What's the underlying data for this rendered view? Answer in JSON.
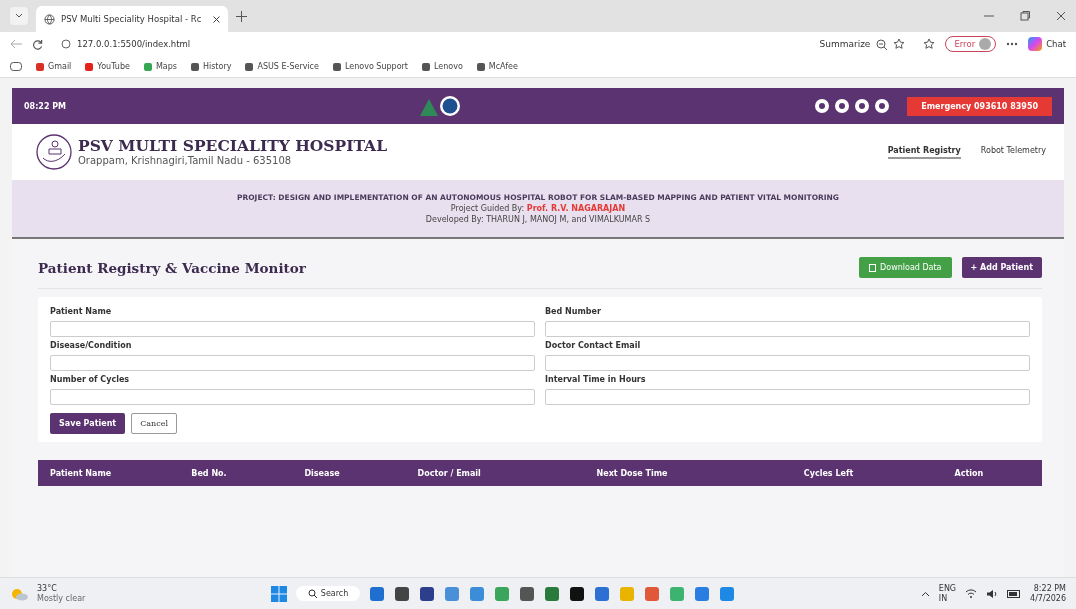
{
  "browser": {
    "tabs": [
      {
        "title": "PSV Multi Speciality Hospital - Rc",
        "selected": true
      }
    ],
    "url": "127.0.0.1:5500/index.html",
    "summarize": "Summarize",
    "profile": "Error",
    "chat": "Chat",
    "bookmarks": [
      {
        "label": "Gmail",
        "color": "#d93025"
      },
      {
        "label": "YouTube",
        "color": "#e62117"
      },
      {
        "label": "Maps",
        "color": "#34a853"
      },
      {
        "label": "History",
        "color": "#555555"
      },
      {
        "label": "ASUS E-Service",
        "color": "#555555"
      },
      {
        "label": "Lenovo Support",
        "color": "#555555"
      },
      {
        "label": "Lenovo",
        "color": "#555555"
      },
      {
        "label": "McAfee",
        "color": "#555555"
      }
    ]
  },
  "topbar": {
    "time": "08:22 PM",
    "emergency": "Emergency 093610 83950"
  },
  "header": {
    "name": "PSV MULTI SPECIALITY HOSPITAL",
    "address": "Orappam, Krishnagiri,Tamil Nadu - 635108",
    "nav": [
      {
        "label": "Patient Registry",
        "selected": true
      },
      {
        "label": "Robot Telemetry",
        "selected": false
      }
    ]
  },
  "banner": {
    "project": "PROJECT: DESIGN AND IMPLEMENTATION OF AN AUTONOMOUS HOSPITAL ROBOT FOR SLAM-BASED MAPPING AND PATIENT VITAL MONITORING",
    "guided_label": "Project Guided By:",
    "guide": "Prof. R.V. NAGARAJAN",
    "developed": "Developed By: THARUN J, MANOJ M, and VIMALKUMAR S"
  },
  "section": {
    "title": "Patient Registry & Vaccine Monitor",
    "download": "Download Data",
    "add": "+ Add Patient"
  },
  "form": {
    "fields": [
      {
        "label": "Patient Name"
      },
      {
        "label": "Bed Number"
      },
      {
        "label": "Disease/Condition"
      },
      {
        "label": "Doctor Contact Email"
      },
      {
        "label": "Number of Cycles"
      },
      {
        "label": "Interval Time in Hours"
      }
    ],
    "save": "Save Patient",
    "cancel": "Cancel"
  },
  "table": {
    "columns": [
      "Patient Name",
      "Bed No.",
      "Disease",
      "Doctor / Email",
      "Next Dose Time",
      "Cycles Left",
      "Action"
    ]
  },
  "taskbar": {
    "temperature": "33°C",
    "weather": "Mostly clear",
    "search": "Search",
    "lang": "ENG",
    "region": "IN",
    "time": "8:22 PM",
    "date": "4/7/2026"
  }
}
